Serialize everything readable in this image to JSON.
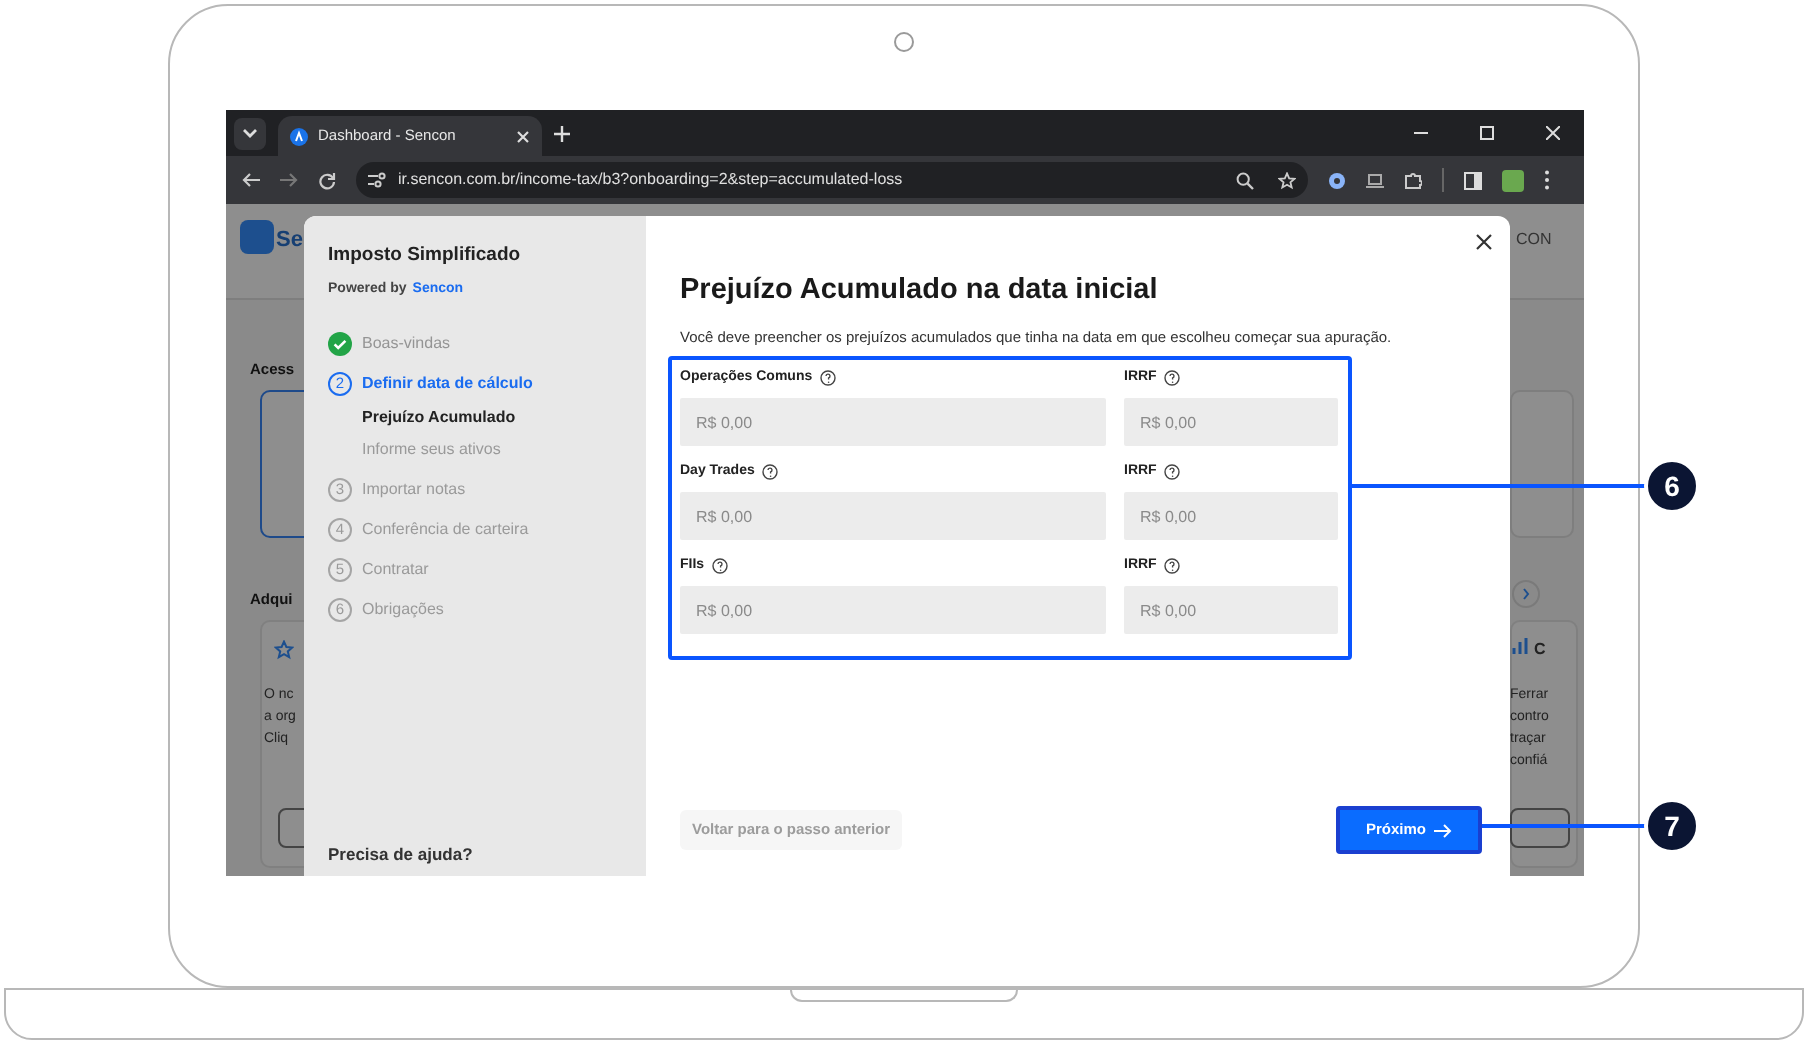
{
  "browser": {
    "tab_title": "Dashboard - Sencon",
    "url": "ir.sencon.com.br/income-tax/b3?onboarding=2&step=accumulated-loss"
  },
  "background_page": {
    "logo_text": "Se",
    "account_text": "CON",
    "section_1": "Acess",
    "section_2": "Adqui",
    "left_card_lines": [
      "O nc",
      "a org",
      "Cliq"
    ],
    "right_card_title": "C",
    "right_card_lines": [
      "Ferrar",
      "contro",
      "traçar",
      "confiá"
    ]
  },
  "sidebar": {
    "title": "Imposto Simplificado",
    "powered_by_label": "Powered by",
    "powered_by_brand": "Sencon",
    "steps": [
      {
        "label": "Boas-vindas",
        "completed": true,
        "current": false
      },
      {
        "number": "2",
        "label": "Definir data de cálculo",
        "completed": false,
        "current": true,
        "children": [
          {
            "label": "Prejuízo Acumulado",
            "selected": true
          },
          {
            "label": "Informe seus ativos",
            "selected": false
          }
        ]
      },
      {
        "number": "3",
        "label": "Importar notas",
        "completed": false,
        "current": false
      },
      {
        "number": "4",
        "label": "Conferência de carteira",
        "completed": false,
        "current": false
      },
      {
        "number": "5",
        "label": "Contratar",
        "completed": false,
        "current": false
      },
      {
        "number": "6",
        "label": "Obrigações",
        "completed": false,
        "current": false
      }
    ],
    "help": "Precisa de ajuda?"
  },
  "modal": {
    "title": "Prejuízo Acumulado na data inicial",
    "description": "Você deve preencher os prejuízos acumulados que tinha na data em que escolheu começar sua apuração.",
    "fields": [
      {
        "label": "Operações Comuns",
        "placeholder": "R$ 0,00"
      },
      {
        "label": "IRRF",
        "placeholder": "R$ 0,00"
      },
      {
        "label": "Day Trades",
        "placeholder": "R$ 0,00"
      },
      {
        "label": "IRRF",
        "placeholder": "R$ 0,00"
      },
      {
        "label": "FIIs",
        "placeholder": "R$ 0,00"
      },
      {
        "label": "IRRF",
        "placeholder": "R$ 0,00"
      }
    ],
    "back_button": {
      "label": "Voltar para o passo anterior",
      "disabled": true
    },
    "next_button": {
      "label": "Próximo"
    }
  },
  "annotations": [
    {
      "number": "6"
    },
    {
      "number": "7"
    }
  ]
}
